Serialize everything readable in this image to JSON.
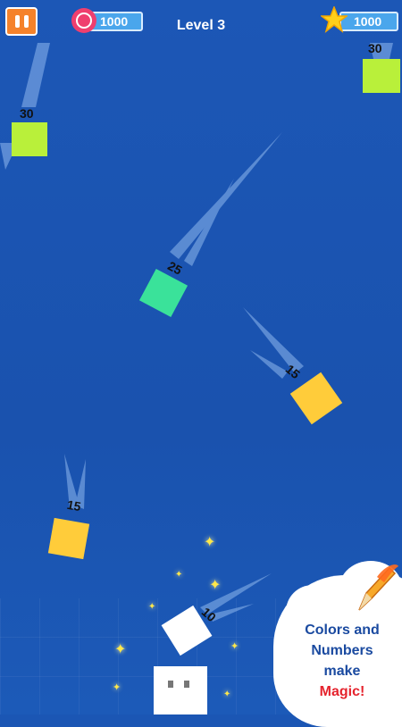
{
  "hud": {
    "timer_value": "1000",
    "level_label": "Level 3",
    "stars_value": "1000",
    "icons": {
      "pause": "pause-icon",
      "timer": "clock-icon",
      "stars": "star-icon"
    },
    "colors": {
      "pause_bg": "#f5822b",
      "pill_bg": "#4aa6ec",
      "clock_bg": "#ef3f6e",
      "star": "#ffcf1a"
    }
  },
  "blocks": [
    {
      "number": "30",
      "color": "#b9f03a"
    },
    {
      "number": "30",
      "color": "#b9f03a"
    },
    {
      "number": "25",
      "color": "#3ae29a"
    },
    {
      "number": "15",
      "color": "#ffcc3a"
    },
    {
      "number": "15",
      "color": "#ffcc3a"
    },
    {
      "number": "10",
      "color": "#ffffff"
    }
  ],
  "promo": {
    "line1": "Colors and",
    "line2": "Numbers",
    "line3": "make",
    "line4": "Magic!",
    "icon": "pencil-icon"
  }
}
